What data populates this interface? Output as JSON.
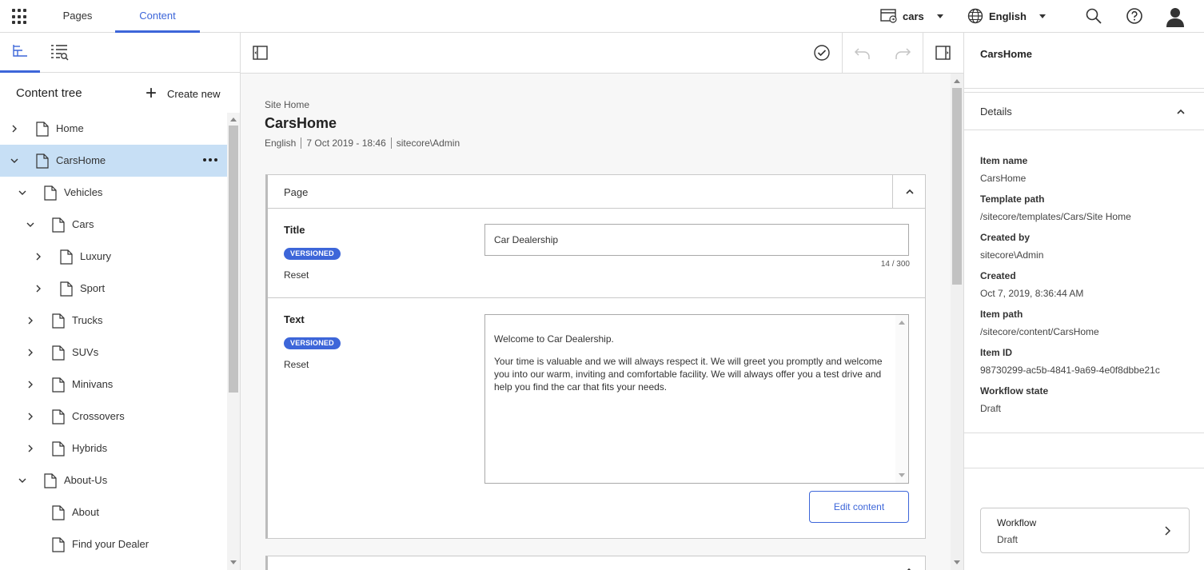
{
  "topbar": {
    "tabs": [
      {
        "label": "Pages",
        "active": false
      },
      {
        "label": "Content",
        "active": true
      }
    ],
    "site": "cars",
    "language": "English",
    "accent": "#3d66d9"
  },
  "left": {
    "tree_title": "Content tree",
    "create_new": "Create new",
    "items": [
      {
        "label": "Home",
        "expanded": false
      },
      {
        "label": "CarsHome",
        "expanded": true,
        "selected": true
      },
      {
        "label": "Vehicles",
        "expanded": true
      },
      {
        "label": "Cars",
        "expanded": true
      },
      {
        "label": "Luxury",
        "expanded": false
      },
      {
        "label": "Sport",
        "expanded": false
      },
      {
        "label": "Trucks",
        "expanded": false
      },
      {
        "label": "SUVs",
        "expanded": false
      },
      {
        "label": "Minivans",
        "expanded": false
      },
      {
        "label": "Crossovers",
        "expanded": false
      },
      {
        "label": "Hybrids",
        "expanded": false
      },
      {
        "label": "About-Us",
        "expanded": true
      },
      {
        "label": "About"
      },
      {
        "label": "Find your Dealer"
      }
    ]
  },
  "center": {
    "breadcrumb": "Site Home",
    "title": "CarsHome",
    "meta": [
      "English",
      "7 Oct 2019 - 18:46",
      "sitecore\\Admin"
    ],
    "section_title": "Page",
    "fields": {
      "title": {
        "label": "Title",
        "badge": "VERSIONED",
        "reset": "Reset",
        "value": "Car Dealership",
        "counter": "14 / 300"
      },
      "text": {
        "label": "Text",
        "badge": "VERSIONED",
        "reset": "Reset",
        "para1": "Welcome to Car Dealership.",
        "para2": "Your time is valuable and we will always respect it. We will greet you promptly and welcome you into our warm, inviting and comfortable facility. We will always offer you a test drive and help you find the car that fits your needs."
      }
    },
    "edit_button": "Edit content"
  },
  "right": {
    "title": "CarsHome",
    "details_label": "Details",
    "details": [
      {
        "label": "Item name",
        "value": "CarsHome"
      },
      {
        "label": "Template path",
        "value": "/sitecore/templates/Cars/Site Home"
      },
      {
        "label": "Created by",
        "value": "sitecore\\Admin"
      },
      {
        "label": "Created",
        "value": "Oct 7, 2019, 8:36:44 AM"
      },
      {
        "label": "Item path",
        "value": "/sitecore/content/CarsHome"
      },
      {
        "label": "Item ID",
        "value": "98730299-ac5b-4841-9a69-4e0f8dbbe21c"
      },
      {
        "label": "Workflow state",
        "value": "Draft"
      }
    ],
    "workflow": {
      "title": "Workflow",
      "state": "Draft"
    }
  }
}
